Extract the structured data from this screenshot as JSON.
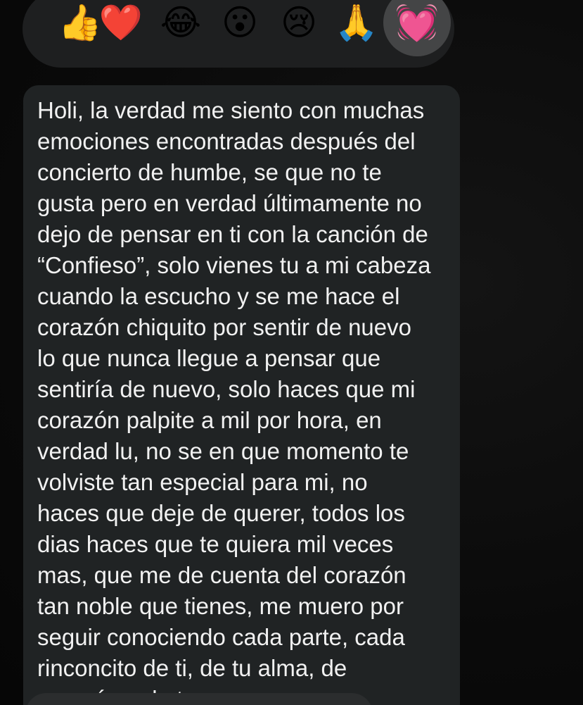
{
  "reactions": [
    {
      "name": "thumbs-up",
      "emoji": "👍",
      "selected": false
    },
    {
      "name": "red-heart",
      "emoji": "❤️",
      "selected": false
    },
    {
      "name": "tears-of-joy",
      "emoji": "😂",
      "selected": false
    },
    {
      "name": "surprised",
      "emoji": "😮",
      "selected": false
    },
    {
      "name": "crying",
      "emoji": "😢",
      "selected": false
    },
    {
      "name": "folded-hands",
      "emoji": "🙏",
      "selected": false
    },
    {
      "name": "pink-heart",
      "emoji": "💓",
      "selected": true
    }
  ],
  "message": {
    "lines": [
      "Holi, la verdad me siento con muchas",
      "emociones encontradas después del",
      "concierto de humbe, se que no te",
      "gusta pero en verdad últimamente no",
      "dejo de pensar en ti con la canción de",
      "“Confieso”, solo vienes tu a mi cabeza",
      "cuando la escucho y se me hace el",
      "corazón chiquito por sentir de nuevo",
      "lo que nunca llegue a pensar que",
      "sentiría de nuevo, solo haces que mi",
      "corazón palpite a mil por hora, en",
      "verdad lu, no se en que momento te",
      "volviste tan especial para mi, no",
      "haces que deje de querer, todos los",
      "dias haces que te quiera mil veces",
      "mas, que me de cuenta del corazón",
      "tan noble que tienes, me muero por",
      "seguir conociendo cada parte, cada",
      "rinconcito de ti, de tu alma, de",
      "corazón y de tu ser"
    ]
  },
  "colors": {
    "background": "#0b0b0b",
    "bubble": "#202324",
    "reaction_bar": "#1e1f20",
    "selected_reaction": "#444546",
    "text": "#f1f1f1"
  }
}
